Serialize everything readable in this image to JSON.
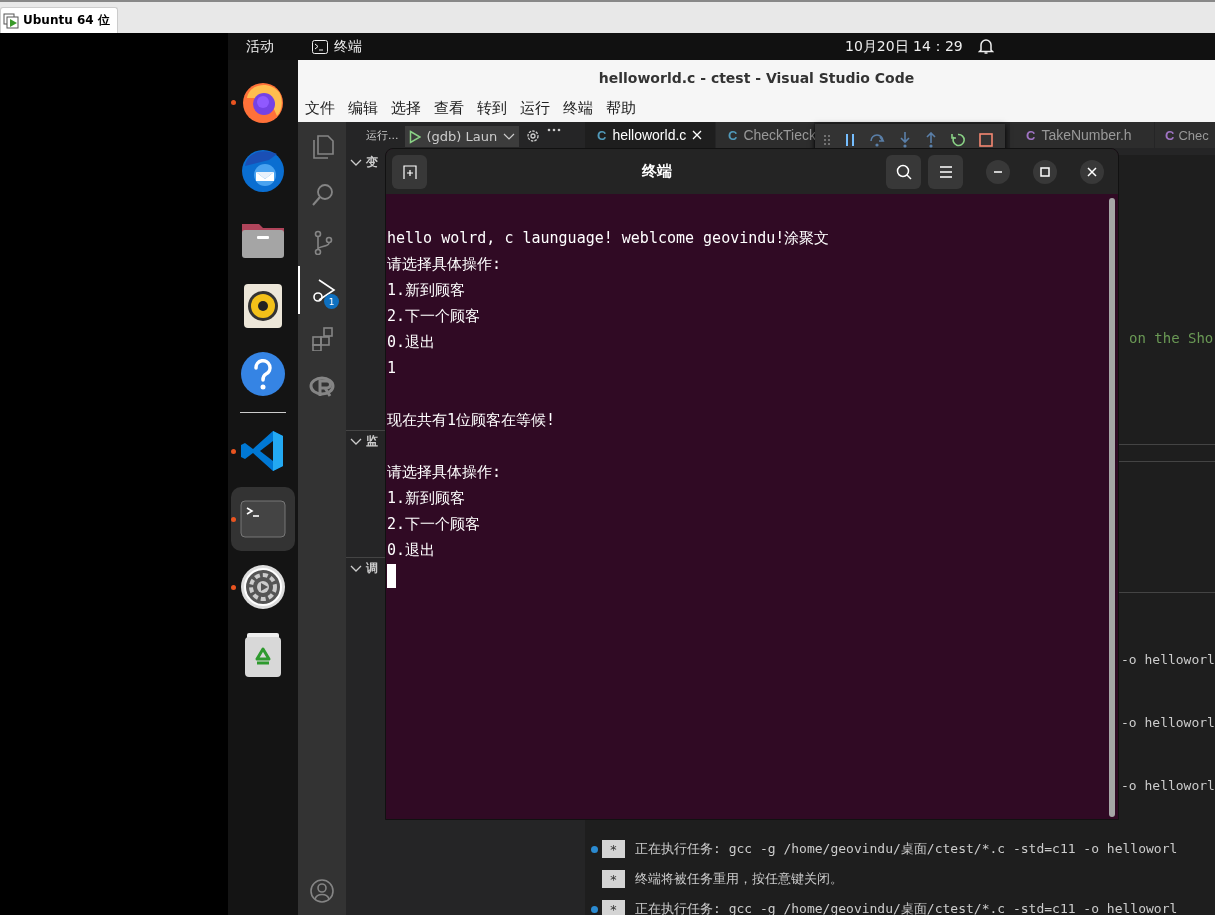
{
  "vm_tab": {
    "title": "Ubuntu 64 位"
  },
  "top_bar": {
    "activities": "活动",
    "app": "终端",
    "clock": "10月20日  14：29"
  },
  "dock": {
    "items": [
      {
        "kind": "firefox",
        "running": true,
        "selected": false
      },
      {
        "kind": "mail",
        "running": false,
        "selected": false
      },
      {
        "kind": "files",
        "running": false,
        "selected": false
      },
      {
        "kind": "music",
        "running": false,
        "selected": false
      },
      {
        "kind": "help",
        "running": false,
        "selected": false
      },
      {
        "kind": "separator"
      },
      {
        "kind": "vscode",
        "running": true,
        "selected": false
      },
      {
        "kind": "terminal",
        "running": true,
        "selected": true
      },
      {
        "kind": "settings",
        "running": true,
        "selected": false
      },
      {
        "kind": "trash",
        "running": false,
        "selected": false
      }
    ]
  },
  "vscode": {
    "title": "helloworld.c - ctest - Visual Studio Code",
    "menu": [
      "文件",
      "编辑",
      "选择",
      "查看",
      "转到",
      "运行",
      "终端",
      "帮助"
    ],
    "activity_bar": {
      "items": [
        {
          "kind": "explorer",
          "selected": false
        },
        {
          "kind": "search",
          "selected": false
        },
        {
          "kind": "git",
          "selected": false
        },
        {
          "kind": "debug",
          "selected": true,
          "badge": "1"
        },
        {
          "kind": "extensions",
          "selected": false
        },
        {
          "kind": "r",
          "selected": false
        }
      ]
    },
    "sidebar": {
      "label": "运行...",
      "config": "(gdb) Laun",
      "sections": [
        {
          "title": "变",
          "expanded": true
        },
        {
          "title": "监",
          "expanded": true
        },
        {
          "title": "调",
          "expanded": true
        }
      ]
    },
    "tabs": [
      {
        "icon": "C",
        "color": "#519aba",
        "label": "helloworld.c",
        "selected": true
      },
      {
        "icon": "C",
        "color": "#519aba",
        "label": "CheckTieck",
        "selected": false
      },
      {
        "icon": "C",
        "color": "#a074c4",
        "label": "TakeNumber.h",
        "selected": false
      },
      {
        "icon": "C",
        "color": "#a074c4",
        "label": "Chec",
        "selected": false
      }
    ],
    "editor_lines": [
      "on the Sho"
    ],
    "panel_rows": [
      {
        "kind": "tail",
        "text": "-o helloworl"
      },
      {
        "kind": "tail",
        "text": "-o helloworl"
      },
      {
        "kind": "tail",
        "text": "-o helloworl"
      },
      {
        "kind": "task",
        "dot": true,
        "marker": "*",
        "text": "正在执行任务: gcc -g /home/geovindu/桌面/ctest/*.c -std=c11 -o helloworl"
      },
      {
        "kind": "task",
        "dot": false,
        "marker": "*",
        "text": "终端将被任务重用，按任意键关闭。"
      },
      {
        "kind": "task",
        "dot": true,
        "marker": "*",
        "text": "正在执行任务: gcc -g /home/geovindu/桌面/ctest/*.c -std=c11 -o helloworl"
      }
    ]
  },
  "terminal": {
    "title": "终端",
    "cursor": true,
    "lines": [
      {
        "kind": "text",
        "text": "hello wolrd, c launguage! weblcome geovindu!涂聚文"
      },
      {
        "kind": "text",
        "text": "请选择具体操作:"
      },
      {
        "kind": "text",
        "text": "1.新到顾客"
      },
      {
        "kind": "text",
        "text": "2.下一个顾客"
      },
      {
        "kind": "text",
        "text": "0.退出"
      },
      {
        "kind": "text",
        "text": "1"
      },
      {
        "kind": "blank"
      },
      {
        "kind": "text",
        "text": "现在共有1位顾客在等候!"
      },
      {
        "kind": "blank"
      },
      {
        "kind": "text",
        "text": "请选择具体操作:"
      },
      {
        "kind": "text",
        "text": "1.新到顾客"
      },
      {
        "kind": "text",
        "text": "2.下一个顾客"
      },
      {
        "kind": "text",
        "text": "0.退出"
      }
    ]
  }
}
